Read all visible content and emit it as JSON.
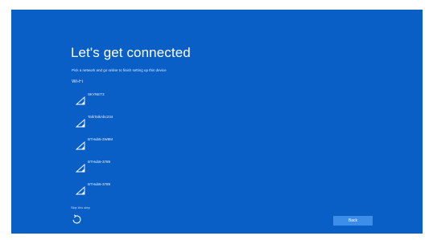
{
  "colors": {
    "background": "#0a5fc6",
    "accent_button": "#3d8ee8",
    "text": "#ffffff"
  },
  "page": {
    "title": "Let's get connected",
    "subtitle": "Pick a network and go online to finish setting up this device",
    "section_label": "Wi-Fi"
  },
  "networks": [
    {
      "name": "SKYNET3",
      "icon": "wifi-icon"
    },
    {
      "name": "TalkTalkAbc234",
      "icon": "wifi-icon"
    },
    {
      "name": "BTHub5-2W8M",
      "icon": "wifi-icon"
    },
    {
      "name": "BTHub6-3789",
      "icon": "wifi-icon"
    },
    {
      "name": "BTHub6-3789",
      "icon": "wifi-icon"
    }
  ],
  "footer": {
    "skip_label": "Skip this step",
    "back_label": "Back",
    "accessibility_icon": "ease-of-access-icon"
  }
}
